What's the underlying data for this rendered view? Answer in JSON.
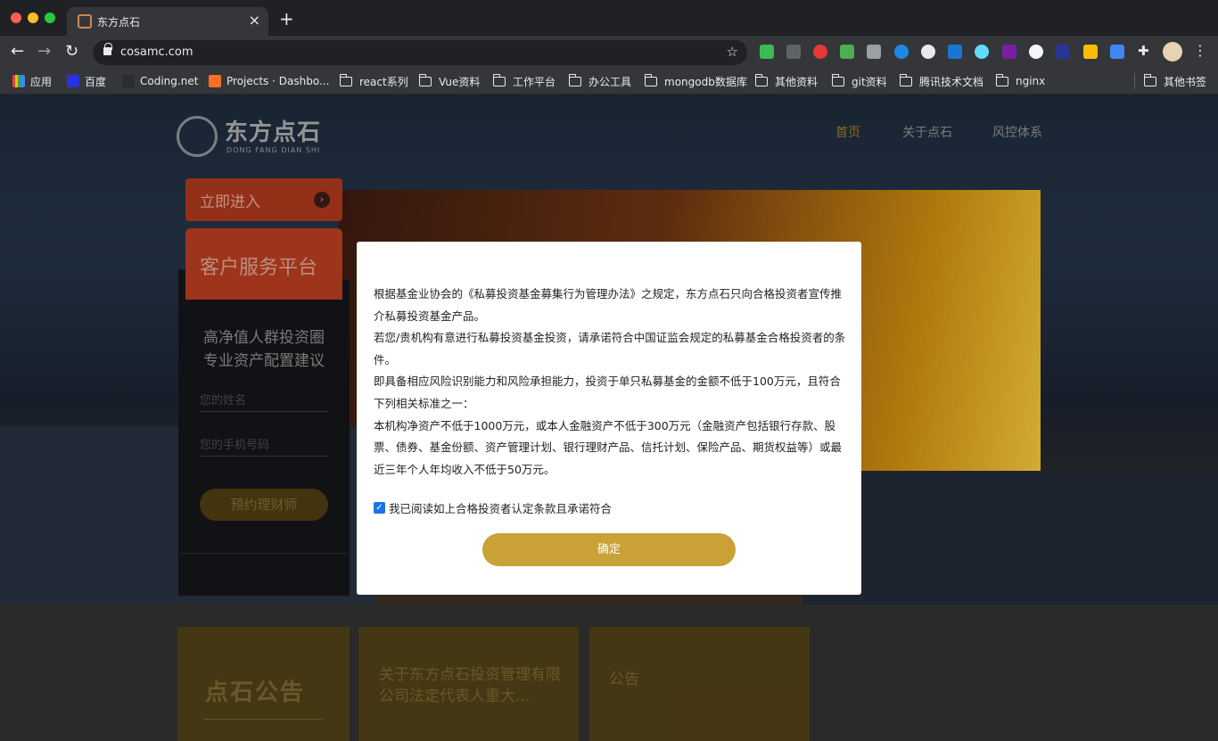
{
  "browser": {
    "tab_title": "东方点石",
    "url": "cosamc.com",
    "bookmarks": [
      {
        "label": "应用",
        "icon": "apps-grid-icon"
      },
      {
        "label": "百度",
        "icon": "baidu-icon"
      },
      {
        "label": "Coding.net",
        "icon": "coding-icon"
      },
      {
        "label": "Projects · Dashbo...",
        "icon": "gitlab-icon"
      },
      {
        "label": "react系列",
        "icon": "folder-icon"
      },
      {
        "label": "Vue资料",
        "icon": "folder-icon"
      },
      {
        "label": "工作平台",
        "icon": "folder-icon"
      },
      {
        "label": "办公工具",
        "icon": "folder-icon"
      },
      {
        "label": "mongodb数据库",
        "icon": "folder-icon"
      },
      {
        "label": "其他资料",
        "icon": "folder-icon"
      },
      {
        "label": "git资料",
        "icon": "folder-icon"
      },
      {
        "label": "腾讯技术文档",
        "icon": "folder-icon"
      },
      {
        "label": "nginx",
        "icon": "folder-icon"
      }
    ],
    "other_bookmarks": "其他书签"
  },
  "site": {
    "logo_text": "东方点石",
    "logo_sub": "DONG FANG DIAN SHI",
    "nav": [
      "首页",
      "关于点石",
      "风控体系"
    ],
    "enter_label": "立即进入",
    "service_title": "客户服务平台",
    "slogan": [
      "高净值人群投资圈",
      "专业资产配置建议"
    ],
    "name_placeholder": "您的姓名",
    "phone_placeholder": "您的手机号码",
    "book_button": "预约理财师",
    "notice_title": "点石公告",
    "notice_text": "关于东方点石投资管理有限公司法定代表人重大...",
    "notice_tag": "公告"
  },
  "modal": {
    "paragraphs": [
      "根据基金业协会的《私募投资基金募集行为管理办法》之规定，东方点石只向合格投资者宣传推介私募投资基金产品。",
      "若您/贵机构有意进行私募投资基金投资，请承诺符合中国证监会规定的私募基金合格投资者的条件。",
      "即具备相应风险识别能力和风险承担能力，投资于单只私募基金的金额不低于100万元，且符合下列相关标准之一：",
      "本机构净资产不低于1000万元，或本人金融资产不低于300万元（金融资产包括银行存款、股票、债券、基金份额、资产管理计划、银行理财产品、信托计划、保险产品、期货权益等）或最近三年个人年均收入不低于50万元。"
    ],
    "agree_label": "我已阅读如上合格投资者认定条款且承诺符合",
    "agree_checked": true,
    "confirm_label": "确定"
  },
  "colors": {
    "accent_gold": "#c9a136",
    "brand_red": "#b33c1f",
    "checkbox_blue": "#1a73e8"
  }
}
